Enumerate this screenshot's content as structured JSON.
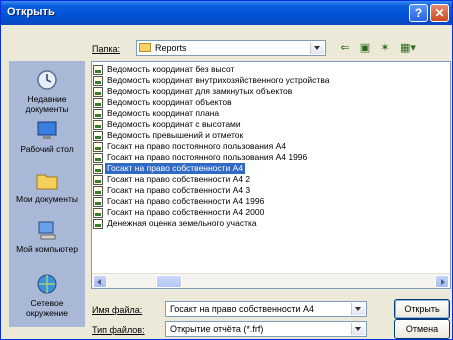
{
  "window": {
    "title": "Открыть"
  },
  "folder": {
    "label": "Папка:",
    "current": "Reports"
  },
  "places": [
    {
      "label": "Недавние документы"
    },
    {
      "label": "Рабочий стол"
    },
    {
      "label": "Мои документы"
    },
    {
      "label": "Мой компьютер"
    },
    {
      "label": "Сетевое окружение"
    }
  ],
  "files": [
    "Ведомость координат без высот",
    "Ведомость координат внутрихозяйственного устройства",
    "Ведомость координат для замкнутых объектов",
    "Ведомость координат объектов",
    "Ведомость координат плана",
    "Ведомость координат с высотами",
    "Ведомость превышений и отметок",
    "Госакт на право постоянного пользования А4",
    "Госакт на право постоянного пользования А4 1996",
    "Госакт на право собственности А4",
    "Госакт на право собственности А4 2",
    "Госакт на право собственности А4 3",
    "Госакт на право собственности А4 1996",
    "Госакт на право собственности А4 2000",
    "Денежная оценка земельного участка"
  ],
  "selected_file": "Госакт на право собственности А4",
  "filename": {
    "label": "Имя файла:",
    "value": "Госакт на право собственности А4"
  },
  "filetype": {
    "label": "Тип файлов:",
    "value": "Открытие отчёта (*.frf)"
  },
  "buttons": {
    "open": "Открыть",
    "cancel": "Отмена"
  },
  "icons": {
    "help": "?",
    "close": "✕"
  }
}
